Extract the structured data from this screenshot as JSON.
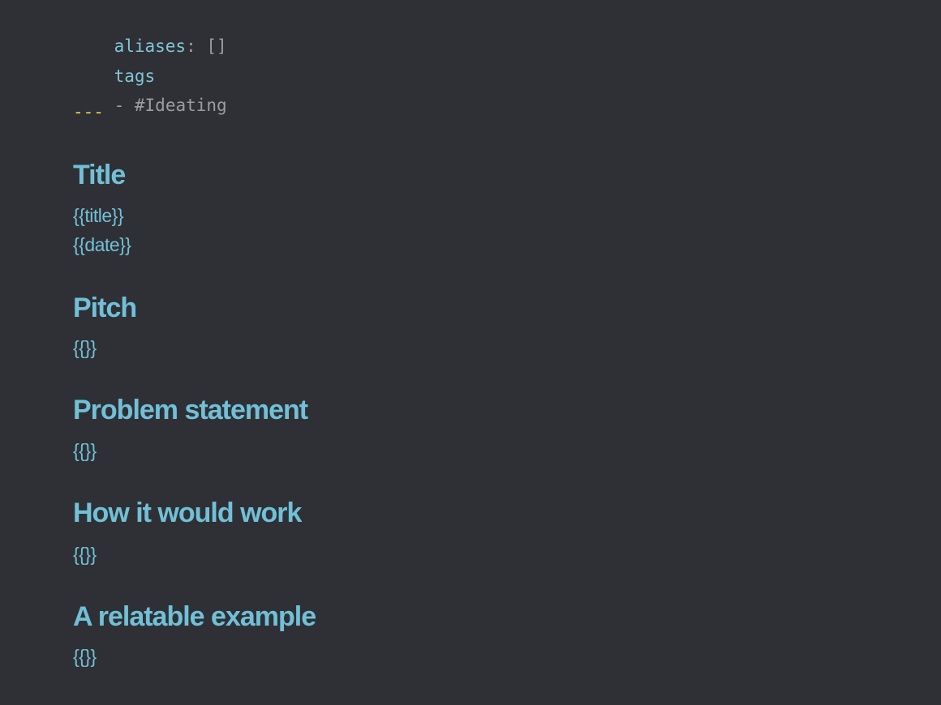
{
  "frontmatter": {
    "aliases_key": "aliases",
    "aliases_sep": ":",
    "aliases_value": "[]",
    "tags_key": "tags",
    "tag_dash": "-",
    "tag_value": "#Ideating",
    "closing_delimiter": "---"
  },
  "sections": [
    {
      "heading": "Title",
      "lines": [
        "{{title}}",
        "{{date}}"
      ]
    },
    {
      "heading": "Pitch",
      "lines": [
        "{{}}"
      ]
    },
    {
      "heading": "Problem statement",
      "lines": [
        "{{}}"
      ]
    },
    {
      "heading": "How it would work",
      "lines": [
        "{{}}"
      ]
    },
    {
      "heading": "A relatable example",
      "lines": [
        "{{}}"
      ]
    }
  ],
  "colors": {
    "background": "#2f3035",
    "heading": "#71c0d7",
    "yaml_key": "#7fc6d6",
    "yaml_muted": "#9a9da3",
    "yaml_delimiter": "#e3d24d"
  }
}
